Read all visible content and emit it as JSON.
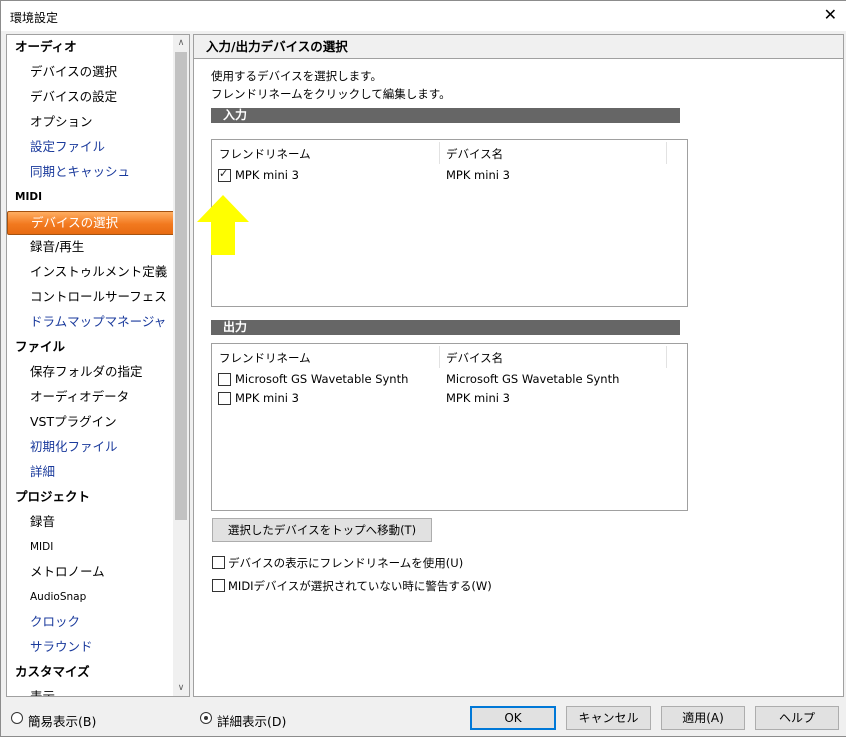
{
  "window": {
    "title": "環境設定",
    "close_glyph": "✕"
  },
  "tree": {
    "items": [
      {
        "label": "オーディオ",
        "kind": "cat"
      },
      {
        "label": "デバイスの選択",
        "kind": "sub"
      },
      {
        "label": "デバイスの設定",
        "kind": "sub"
      },
      {
        "label": "オプション",
        "kind": "sub"
      },
      {
        "label": "設定ファイル",
        "kind": "sub link"
      },
      {
        "label": "同期とキャッシュ",
        "kind": "sub link"
      },
      {
        "label": "MIDI",
        "kind": "cat small"
      },
      {
        "label": "デバイスの選択",
        "kind": "sub sel"
      },
      {
        "label": "録音/再生",
        "kind": "sub"
      },
      {
        "label": "インストゥルメント定義",
        "kind": "sub"
      },
      {
        "label": "コントロールサーフェス",
        "kind": "sub"
      },
      {
        "label": "ドラムマップマネージャ",
        "kind": "sub link"
      },
      {
        "label": "ファイル",
        "kind": "cat"
      },
      {
        "label": "保存フォルダの指定",
        "kind": "sub"
      },
      {
        "label": "オーディオデータ",
        "kind": "sub"
      },
      {
        "label": "VSTプラグイン",
        "kind": "sub"
      },
      {
        "label": "初期化ファイル",
        "kind": "sub link"
      },
      {
        "label": "詳細",
        "kind": "sub link"
      },
      {
        "label": "プロジェクト",
        "kind": "cat"
      },
      {
        "label": "録音",
        "kind": "sub"
      },
      {
        "label": "MIDI",
        "kind": "sub small"
      },
      {
        "label": "メトロノーム",
        "kind": "sub"
      },
      {
        "label": "AudioSnap",
        "kind": "sub small"
      },
      {
        "label": "クロック",
        "kind": "sub link"
      },
      {
        "label": "サラウンド",
        "kind": "sub link"
      },
      {
        "label": "カスタマイズ",
        "kind": "cat"
      },
      {
        "label": "表示",
        "kind": "sub"
      }
    ],
    "scroll_up": "∧",
    "scroll_down": "∨"
  },
  "panel": {
    "title": "入力/出力デバイスの選択",
    "desc1": "使用するデバイスを選択します。",
    "desc2": "フレンドリネームをクリックして編集します。",
    "input_section": "入力",
    "output_section": "出力",
    "col_friendly": "フレンドリネーム",
    "col_device": "デバイス名",
    "inputs": [
      {
        "friendly": "MPK mini 3",
        "device": "MPK mini 3",
        "checked": true
      }
    ],
    "outputs": [
      {
        "friendly": "Microsoft GS Wavetable Synth",
        "device": "Microsoft GS Wavetable Synth",
        "checked": false
      },
      {
        "friendly": "MPK mini 3",
        "device": "MPK mini 3",
        "checked": false
      }
    ],
    "move_top_button": "選択したデバイスをトップへ移動(T)",
    "option_friendly": "デバイスの表示にフレンドリネームを使用(U)",
    "option_warn": "MIDIデバイスが選択されていない時に警告する(W)",
    "check_glyph": "✓"
  },
  "footer": {
    "simple_view": "簡易表示(B)",
    "detail_view": "詳細表示(D)",
    "selected_view": "detail",
    "ok": "OK",
    "cancel": "キャンセル",
    "apply": "適用(A)",
    "help": "ヘルプ"
  },
  "colors": {
    "selection": "#f2791f",
    "arrow": "#ffff00",
    "section": "#666666",
    "link": "#1a3a9c"
  }
}
